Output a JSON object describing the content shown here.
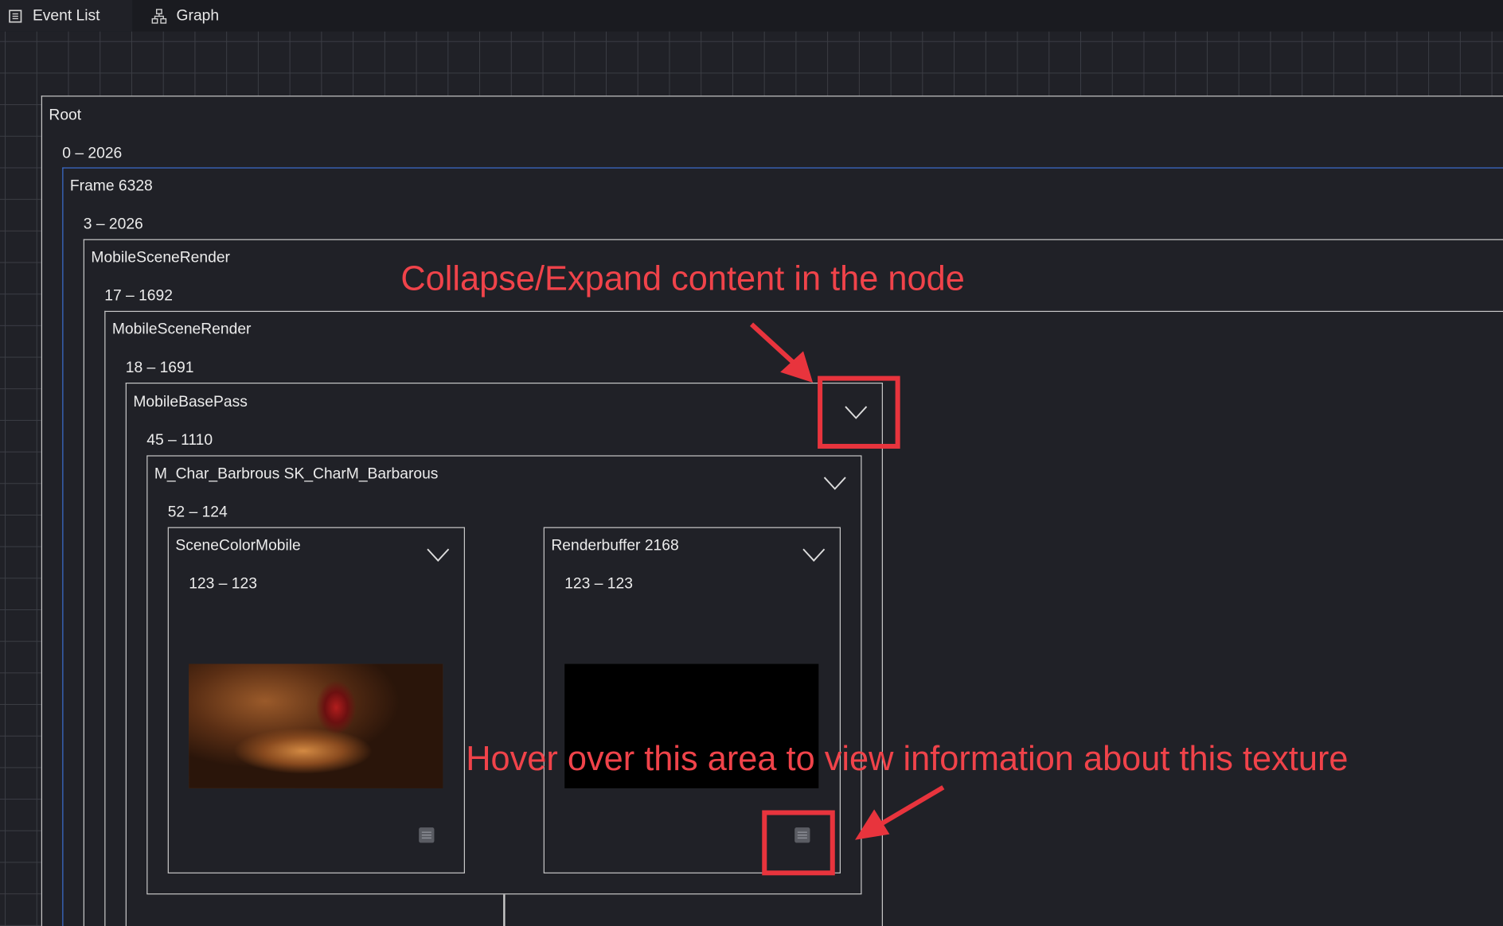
{
  "tabs": [
    {
      "label": "Event List",
      "icon": "list-icon"
    },
    {
      "label": "Graph",
      "icon": "graph-icon"
    }
  ],
  "nodes": {
    "root": {
      "title": "Root",
      "range": "0 – 2026"
    },
    "frame": {
      "title": "Frame 6328",
      "range": "3 – 2026"
    },
    "scene1": {
      "title": "MobileSceneRender",
      "range": "17 – 1692"
    },
    "scene2": {
      "title": "MobileSceneRender",
      "range": "18 – 1691"
    },
    "basepass": {
      "title": "MobileBasePass",
      "range": "45 – 1110"
    },
    "mchar": {
      "title": "M_Char_Barbrous SK_CharM_Barbarous",
      "range": "52 – 124"
    },
    "scenecolor": {
      "title": "SceneColorMobile",
      "range": "123 – 123"
    },
    "renderbuffer": {
      "title": "Renderbuffer 2168",
      "range": "123 – 123"
    }
  },
  "annotations": {
    "collapse": "Collapse/Expand content in the node",
    "hover": "Hover over this area to view information about this texture"
  },
  "colors": {
    "background": "#202127",
    "grid": "#3b3d44",
    "node_border": "#c9c9c9",
    "frame_border": "#3c6fd1",
    "annotation": "#e8343d"
  }
}
